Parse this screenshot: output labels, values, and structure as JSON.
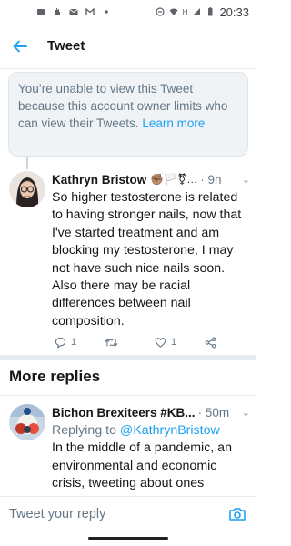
{
  "status_bar": {
    "time": "20:33",
    "network": "H"
  },
  "app_bar": {
    "title": "Tweet"
  },
  "notice": {
    "text": "You’re unable to view this Tweet because this account owner limits who can view their Tweets. ",
    "link": "Learn more"
  },
  "tweet": {
    "author": "Kathryn Bristow",
    "emoji": "✊🏽🏳️⚧…",
    "time": "· 9h",
    "text": "So higher testosterone is related to having stronger nails, now that I've started treatment and am blocking my testosterone, I may not have such nice nails soon. Also there may be racial differences between nail composition.",
    "reply_count": "1",
    "retweet_count": "",
    "like_count": "1"
  },
  "section": {
    "title": "More replies"
  },
  "reply": {
    "author": "Bichon Brexiteers #KB...",
    "time": "· 50m",
    "replying_prefix": "Replying to ",
    "replying_handle": "@KathrynBristow",
    "text": "In the middle of a pandemic, an environmental and economic crisis, tweeting about ones"
  },
  "composer": {
    "placeholder": "Tweet your reply"
  },
  "colors": {
    "accent": "#1da1f2",
    "muted": "#657786",
    "text": "#14171a"
  },
  "icons": {
    "back": "arrow-left-icon",
    "reply": "comment-icon",
    "retweet": "retweet-icon",
    "like": "heart-icon",
    "share": "share-icon",
    "camera": "camera-icon",
    "more": "chevron-down-icon"
  }
}
